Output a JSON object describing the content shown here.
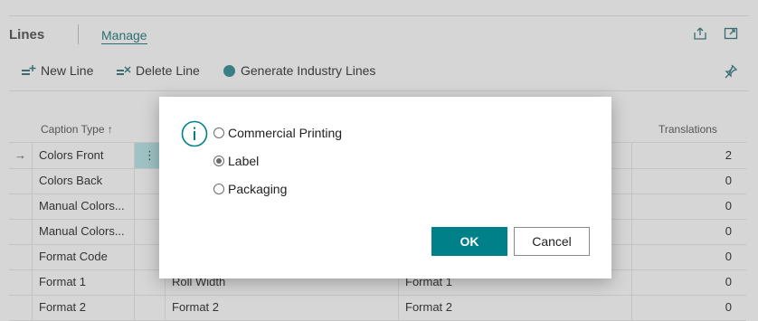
{
  "header": {
    "title": "Lines",
    "tab_manage": "Manage"
  },
  "actions": {
    "new_line": "New Line",
    "delete_line": "Delete Line",
    "generate": "Generate Industry Lines"
  },
  "columns": {
    "caption_type": "Caption Type ↑",
    "translations": "Translations"
  },
  "rows": [
    {
      "arrow": "→",
      "caption": "Colors Front",
      "menu": "⋮",
      "a": "",
      "b": "",
      "translations": "2"
    },
    {
      "arrow": "",
      "caption": "Colors Back",
      "menu": "",
      "a": "",
      "b": "",
      "translations": "0"
    },
    {
      "arrow": "",
      "caption": "Manual Colors...",
      "menu": "",
      "a": "",
      "b": "",
      "translations": "0"
    },
    {
      "arrow": "",
      "caption": "Manual Colors...",
      "menu": "",
      "a": "",
      "b": "",
      "translations": "0"
    },
    {
      "arrow": "",
      "caption": "Format Code",
      "menu": "",
      "a": "",
      "b": "",
      "translations": "0"
    },
    {
      "arrow": "",
      "caption": "Format 1",
      "menu": "",
      "a": "Roll Width",
      "b": "Format 1",
      "translations": "0"
    },
    {
      "arrow": "",
      "caption": "Format 2",
      "menu": "",
      "a": "Format 2",
      "b": "Format 2",
      "translations": "0"
    }
  ],
  "dialog": {
    "options": [
      {
        "label": "Commercial Printing",
        "checked": false
      },
      {
        "label": "Label",
        "checked": true
      },
      {
        "label": "Packaging",
        "checked": false
      }
    ],
    "ok_label": "OK",
    "cancel_label": "Cancel"
  },
  "colors": {
    "accent": "#00818a",
    "tab": "#2a6e72",
    "overlay_bg": "#d6d6d6",
    "selected_cell": "#9fc3c5"
  }
}
